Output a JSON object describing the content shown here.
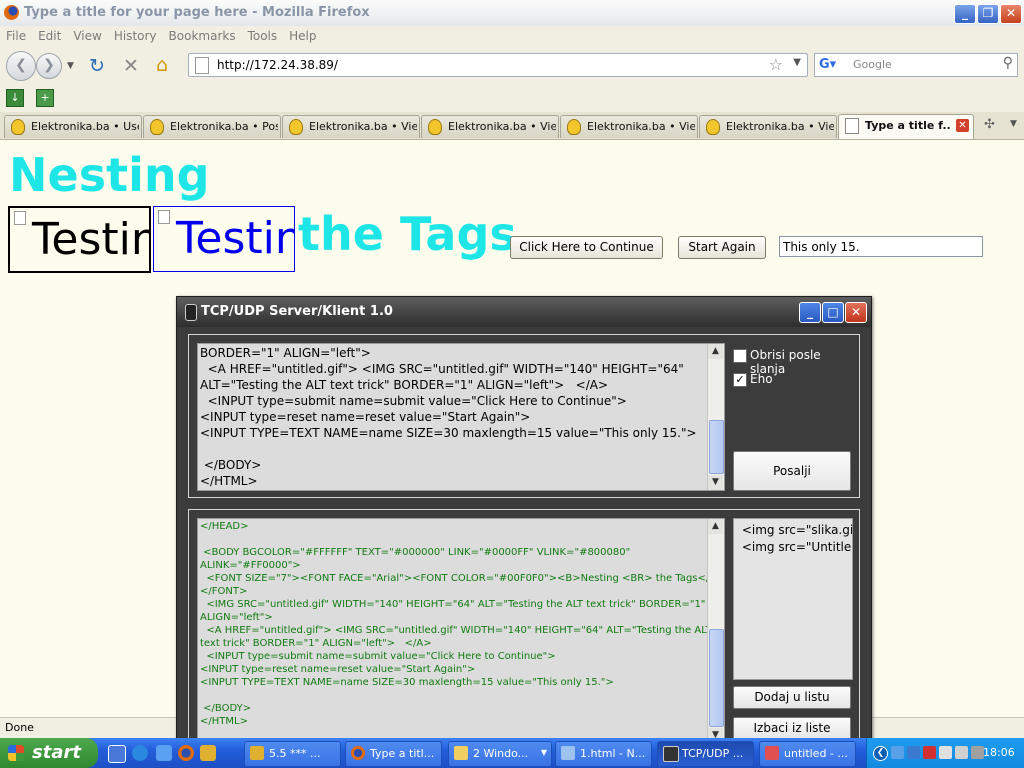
{
  "firefox": {
    "title": "Type a title for your page here - Mozilla Firefox",
    "menu": [
      "File",
      "Edit",
      "View",
      "History",
      "Bookmarks",
      "Tools",
      "Help"
    ],
    "url": "http://172.24.38.89/",
    "search_placeholder": "Google",
    "tabs": [
      {
        "label": "Elektronika.ba • Use..."
      },
      {
        "label": "Elektronika.ba • Pos..."
      },
      {
        "label": "Elektronika.ba • Vie..."
      },
      {
        "label": "Elektronika.ba • Vie..."
      },
      {
        "label": "Elektronika.ba • Vie..."
      },
      {
        "label": "Elektronika.ba • Vie..."
      },
      {
        "label": "Type a title f..."
      }
    ],
    "status": "Done"
  },
  "page": {
    "heading_line1": "Nesting",
    "heading_line2": "the Tags",
    "img_alt": "Testing the ALT text trick",
    "submit_label": "Click Here to Continue",
    "reset_label": "Start Again",
    "text_value": "This only 15."
  },
  "tcp": {
    "title": "TCP/UDP Server/Klient 1.0",
    "send_lines": [
      "BORDER=\"1\" ALIGN=\"left\">",
      "  <A HREF=\"untitled.gif\"> <IMG SRC=\"untitled.gif\" WIDTH=\"140\" HEIGHT=\"64\"",
      "ALT=\"Testing the ALT text trick\" BORDER=\"1\" ALIGN=\"left\">   </A>",
      "  <INPUT type=submit name=submit value=\"Click Here to Continue\">",
      "<INPUT type=reset name=reset value=\"Start Again\">",
      "<INPUT TYPE=TEXT NAME=name SIZE=30 maxlength=15 value=\"This only 15.\">",
      "",
      " </BODY>",
      "</HTML>"
    ],
    "chk_clear_label": "Obrisi posle slanja",
    "chk_clear_checked": false,
    "chk_echo_label": "Eho",
    "chk_echo_checked": true,
    "send_button": "Posalji",
    "recv_lines": [
      "</HEAD>",
      "",
      " <BODY BGCOLOR=\"#FFFFFF\" TEXT=\"#000000\" LINK=\"#0000FF\" VLINK=\"#800080\"",
      "ALINK=\"#FF0000\">",
      "  <FONT SIZE=\"7\"><FONT FACE=\"Arial\"><FONT COLOR=\"#00F0F0\"><B>Nesting <BR> the Tags</B>",
      "</FONT>",
      "  <IMG SRC=\"untitled.gif\" WIDTH=\"140\" HEIGHT=\"64\" ALT=\"Testing the ALT text trick\" BORDER=\"1\"",
      "ALIGN=\"left\">",
      "  <A HREF=\"untitled.gif\"> <IMG SRC=\"untitled.gif\" WIDTH=\"140\" HEIGHT=\"64\" ALT=\"Testing the ALT",
      "text trick\" BORDER=\"1\" ALIGN=\"left\">   </A>",
      "  <INPUT type=submit name=submit value=\"Click Here to Continue\">",
      "<INPUT type=reset name=reset value=\"Start Again\">",
      "<INPUT TYPE=TEXT NAME=name SIZE=30 maxlength=15 value=\"This only 15.\">",
      "",
      " </BODY>",
      "</HTML>"
    ],
    "list_items": [
      " <img src=\"slika.gif\"",
      " <img src=\"Untitled."
    ],
    "add_button": "Dodaj u listu",
    "remove_button": "Izbaci iz liste"
  },
  "taskbar": {
    "start_label": "start",
    "tasks": [
      {
        "label": "5.5 *** ..."
      },
      {
        "label": "Type a titl..."
      },
      {
        "label": "2 Windo..."
      },
      {
        "label": "1.html - N..."
      },
      {
        "label": "TCP/UDP ..."
      },
      {
        "label": "untitled - ..."
      }
    ],
    "clock": "18:06"
  },
  "colors": {
    "heading": "#1ee6e6",
    "page_bg": "#fdfded",
    "code_green": "#127a12"
  }
}
